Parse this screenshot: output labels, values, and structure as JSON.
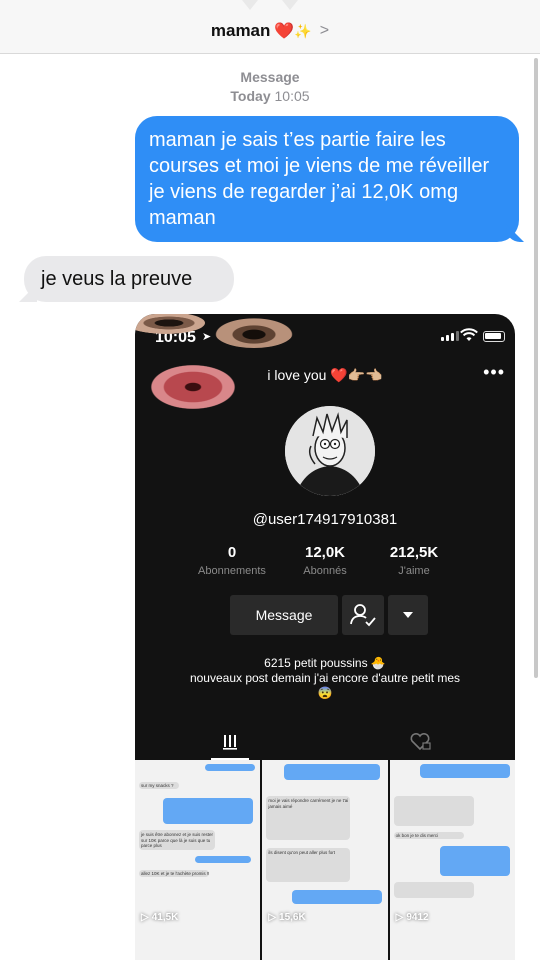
{
  "header": {
    "contact_name": "maman",
    "contact_emoji": "❤️",
    "contact_sparkle": "✨",
    "chevron": ">"
  },
  "thread": {
    "service_label": "Message",
    "date_day": "Today",
    "date_time": "10:05",
    "messages": [
      {
        "direction": "outgoing",
        "text": "maman je sais t’es partie faire les courses et moi je viens de me réveiller je viens de regarder j’ai 12,0K omg maman"
      },
      {
        "direction": "incoming",
        "text": "je veus la preuve"
      }
    ]
  },
  "attachment": {
    "status_time": "10:05",
    "profile_nickname": "i love you ❤️👉🏼👈🏼",
    "username": "@user174917910381",
    "stats": [
      {
        "value": "0",
        "label": "Abonnements"
      },
      {
        "value": "12,0K",
        "label": "Abonnés"
      },
      {
        "value": "212,5K",
        "label": "J'aime"
      }
    ],
    "message_button": "Message",
    "bio_line1": "6215 petit poussins 🐣",
    "bio_line2": "nouveaux post demain j'ai encore d'autre petit mes",
    "bio_line3": "😨",
    "videos": [
      {
        "views": "41,5K"
      },
      {
        "views": "15,6K"
      },
      {
        "views": "9412"
      }
    ],
    "thumb_texts": [
      "sur my snacks ?",
      "je suis être abonnez et je suis rester sur 10K parce que là je suis que tu parce plus",
      "allez 10K et je te l'achète promis !!",
      "moi je vais répondre carrément je ne t'ai jamais aimé",
      "ils disent qu'on peut aller plus fort",
      "ok bon je te dis merci"
    ]
  },
  "colors": {
    "outgoing_bubble": "#2f8ef6",
    "incoming_bubble": "#e9e9eb",
    "tiktok_bg": "#121212",
    "stat_label": "#8a8a8a"
  }
}
